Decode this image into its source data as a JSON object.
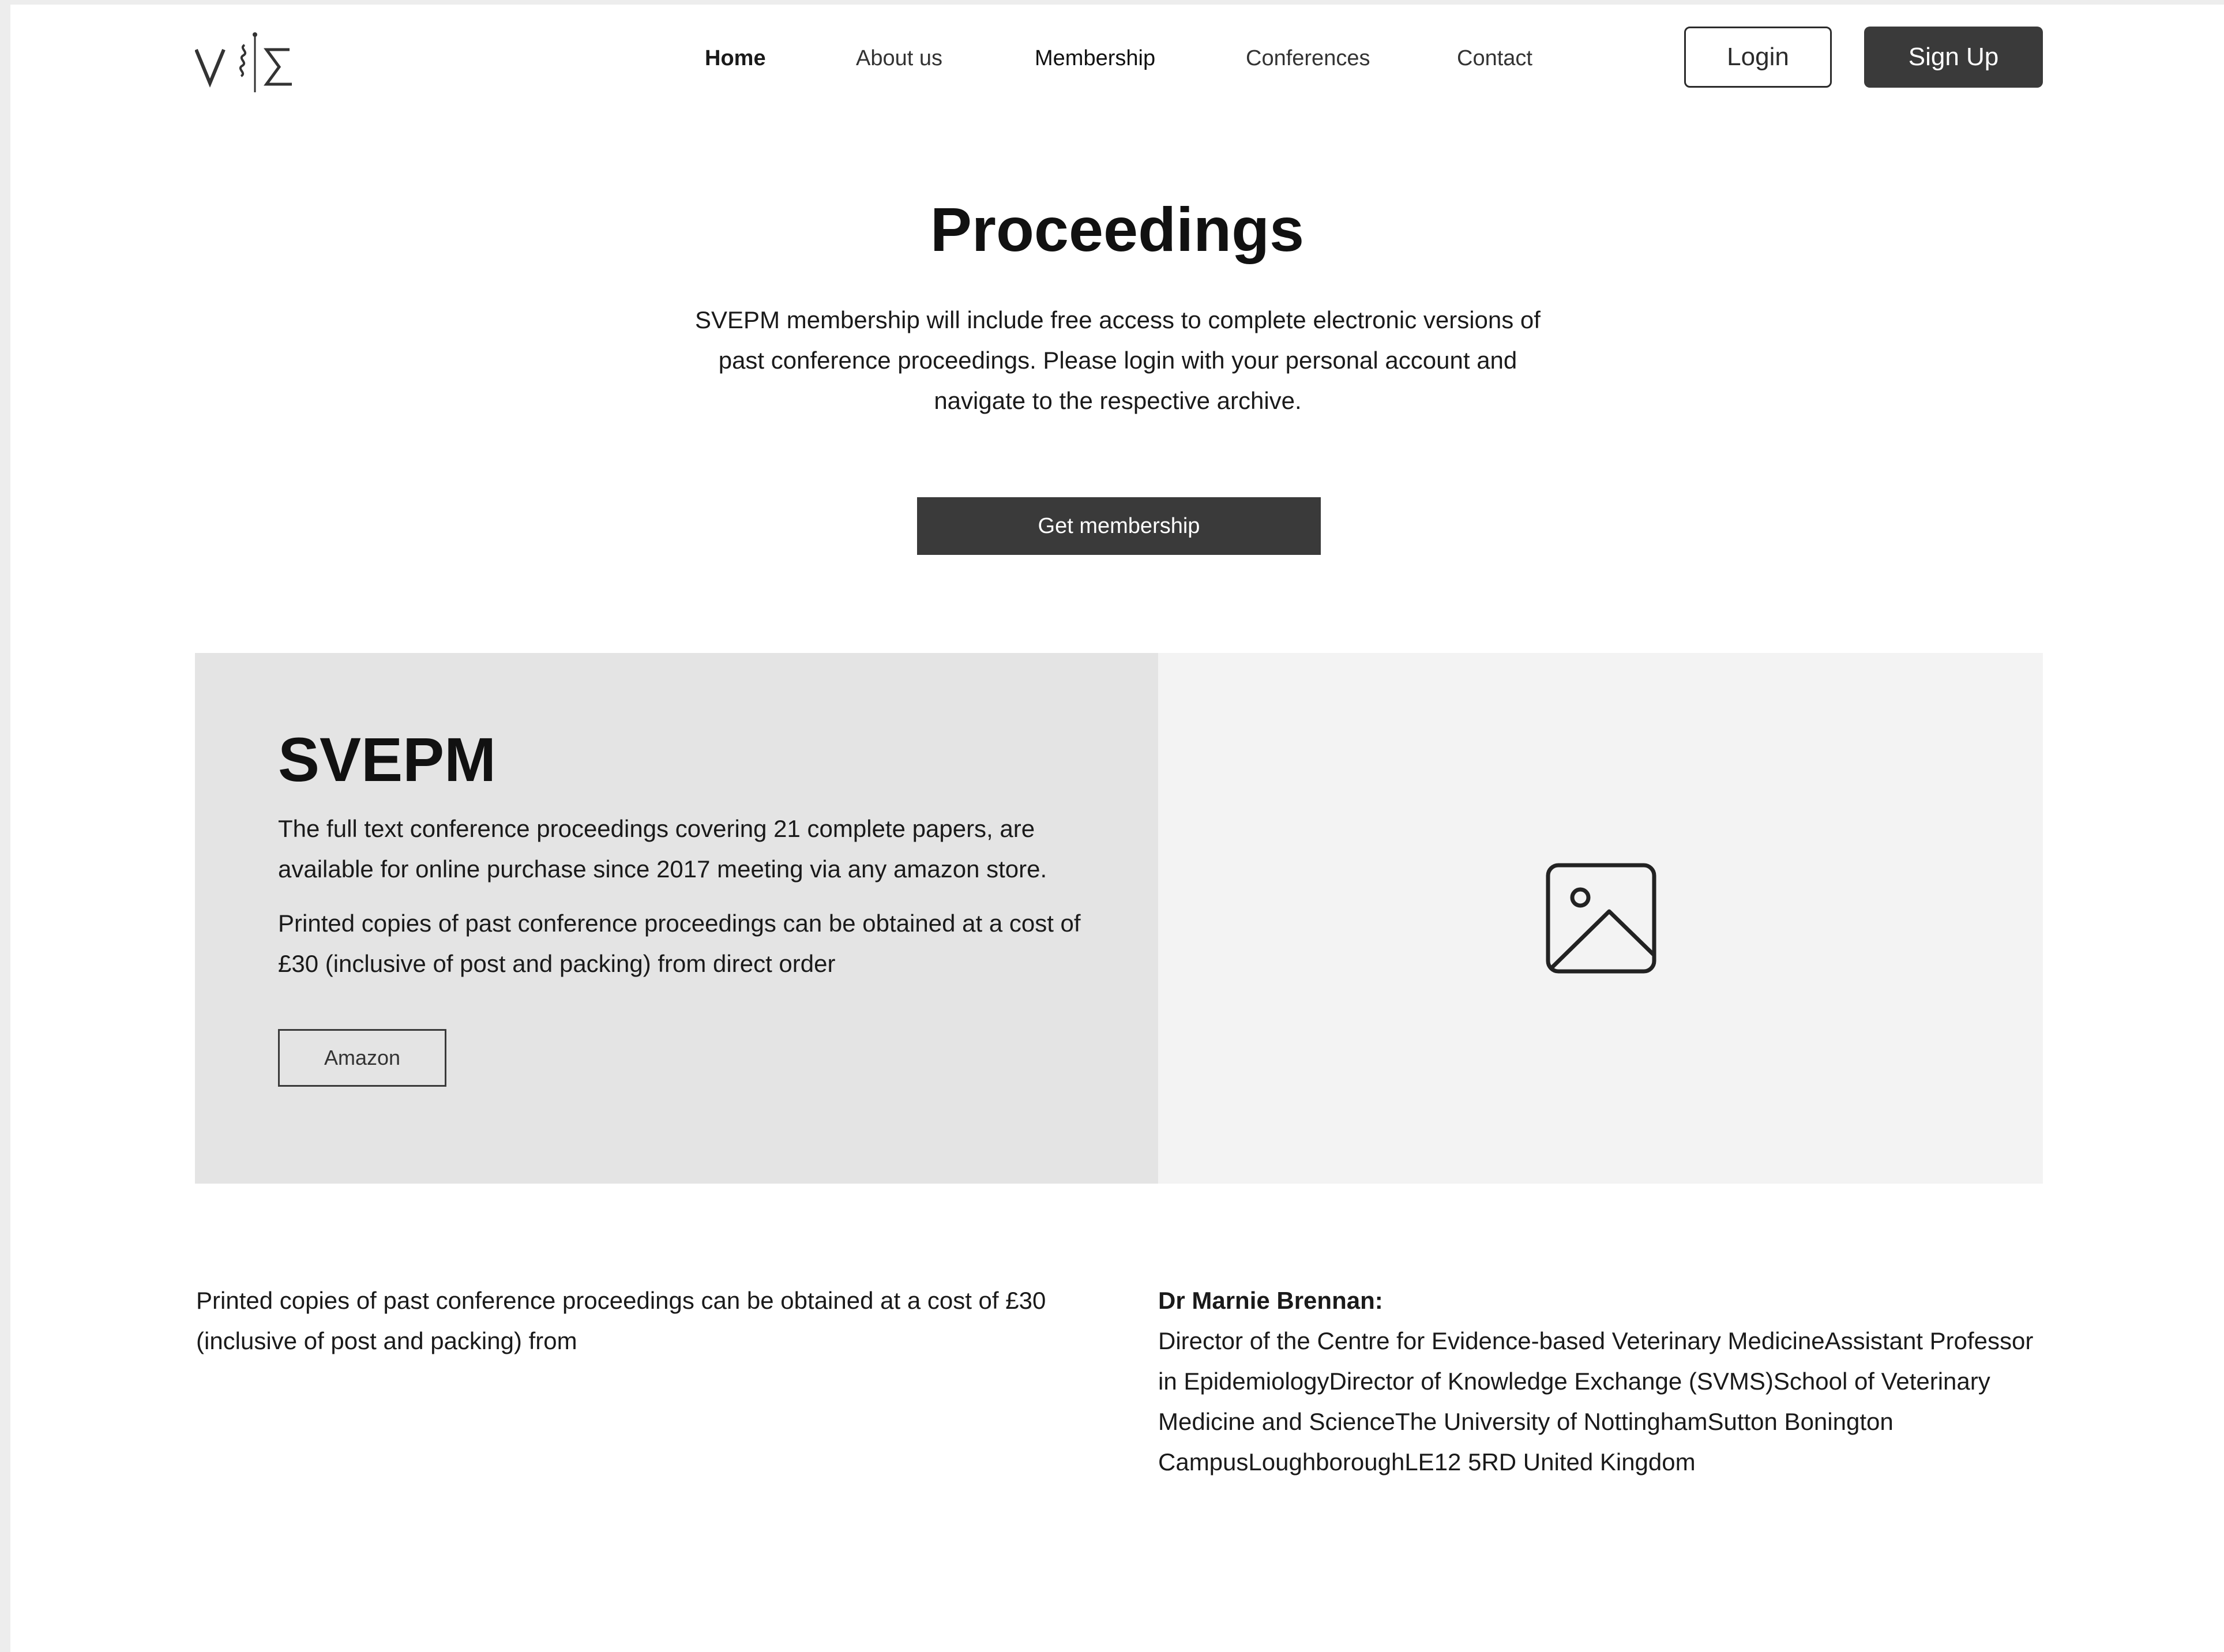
{
  "header": {
    "logo_text": "VSΣ",
    "nav": [
      "Home",
      "About us",
      "Membership",
      "Conferences",
      "Contact"
    ],
    "login_label": "Login",
    "signup_label": "Sign Up"
  },
  "hero": {
    "title": "Proceedings",
    "text": "SVEPM membership will include free access to complete electronic versions of past conference proceedings. Please login with your personal account and navigate to the respective archive.",
    "button_label": "Get membership"
  },
  "feature": {
    "title": "SVEPM",
    "paragraph1": "The full text conference proceedings covering 21 complete papers, are available for online purchase since 2017 meeting via any amazon store.",
    "paragraph2": "Printed copies of past conference proceedings can be obtained at a cost of £30 (inclusive of post and packing) from direct order",
    "button_label": "Amazon",
    "image_icon": "image-placeholder-icon"
  },
  "info": {
    "left_text": "Printed copies of past conference proceedings can be obtained at a cost of £30 (inclusive of post and packing) from",
    "contact_name": "Dr Marnie Brennan:",
    "contact_details": "Director of the Centre for Evidence-based Veterinary MedicineAssistant Professor in EpidemiologyDirector of Knowledge Exchange (SVMS)School of Veterinary Medicine and ScienceThe University of NottinghamSutton Bonington CampusLoughboroughLE12 5RD United Kingdom"
  },
  "colors": {
    "dark_button": "#3a3a3a",
    "feature_left_bg": "#e4e4e4",
    "feature_right_bg": "#f3f3f3"
  }
}
